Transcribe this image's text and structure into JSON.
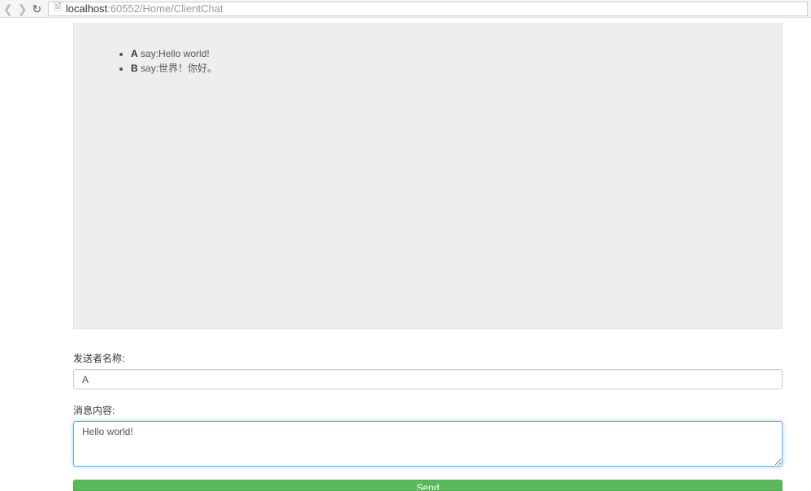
{
  "browser": {
    "url_host": "localhost",
    "url_path": ":60552/Home/ClientChat"
  },
  "chat": {
    "messages": [
      {
        "sender": "A",
        "say_word": "say:",
        "text": "Hello world!"
      },
      {
        "sender": "B",
        "say_word": "say:",
        "text": "世界！你好。"
      }
    ]
  },
  "form": {
    "sender_label": "发送者名称:",
    "sender_value": "A",
    "message_label": "消息内容:",
    "message_value": "Hello world!",
    "send_button": "Send"
  }
}
